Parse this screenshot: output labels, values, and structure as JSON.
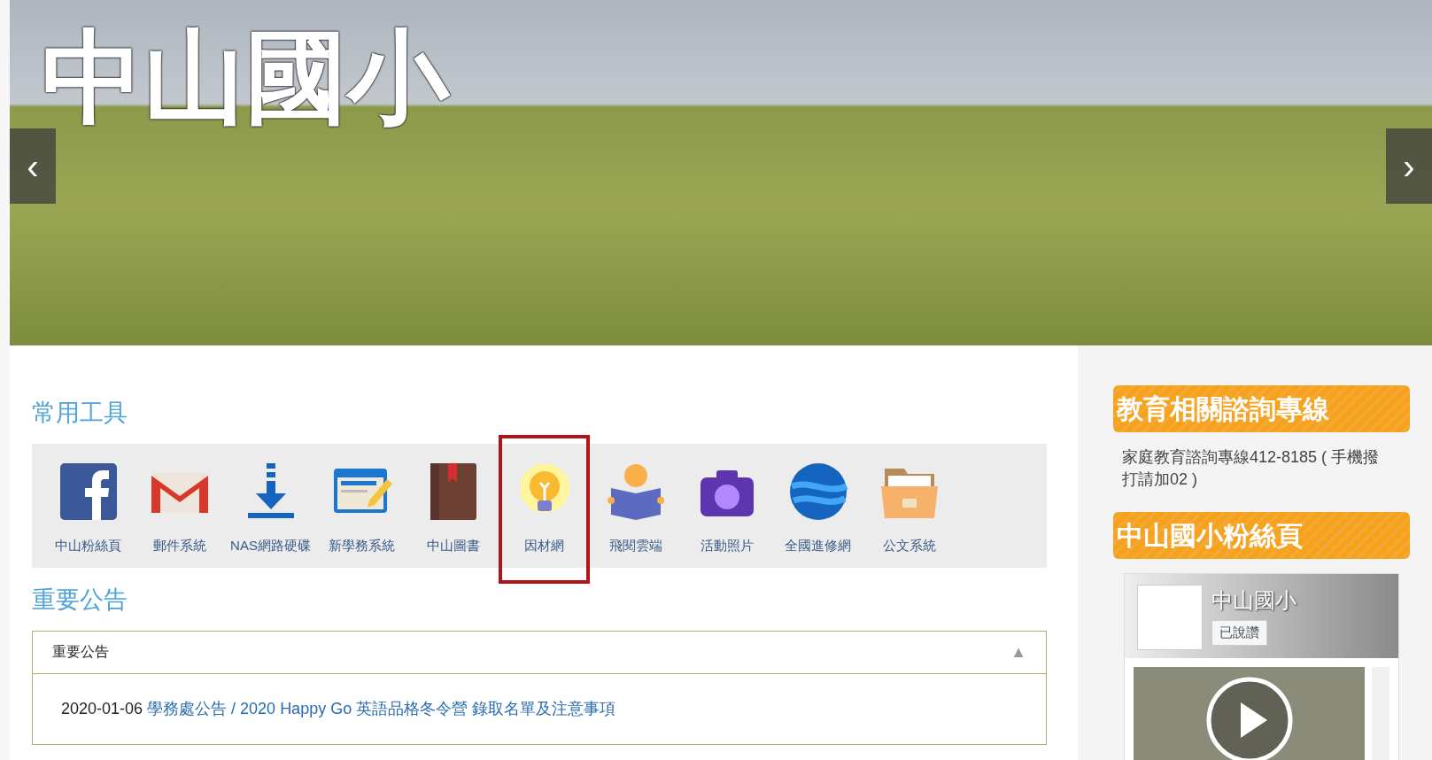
{
  "banner": {
    "logo": "中山國小",
    "prev": "‹",
    "next": "›"
  },
  "tools_heading": "常用工具",
  "tools": [
    {
      "kind": "facebook",
      "label": "中山粉絲頁",
      "highlighted": false
    },
    {
      "kind": "mail",
      "label": "郵件系統",
      "highlighted": false
    },
    {
      "kind": "download",
      "label": "NAS網路硬碟",
      "highlighted": false
    },
    {
      "kind": "form",
      "label": "新學務系統",
      "highlighted": false
    },
    {
      "kind": "book",
      "label": "中山圖書",
      "highlighted": false
    },
    {
      "kind": "bulb",
      "label": "因材網",
      "highlighted": true
    },
    {
      "kind": "reader",
      "label": "飛閱雲端",
      "highlighted": false
    },
    {
      "kind": "camera",
      "label": "活動照片",
      "highlighted": false
    },
    {
      "kind": "globe",
      "label": "全國進修網",
      "highlighted": false
    },
    {
      "kind": "folder",
      "label": "公文系統",
      "highlighted": false
    }
  ],
  "notice_heading": "重要公告",
  "notice_panel": {
    "title": "重要公告",
    "toggle": "▲",
    "expanded": true,
    "items": [
      {
        "date": "2020-01-06",
        "link": "學務處公告 / 2020 Happy Go 英語品格冬令營 錄取名單及注意事項"
      }
    ]
  },
  "sidebar": [
    {
      "kind": "text",
      "title": "教育相關諮詢專線",
      "body": "家庭教育諮詢專線412-8185 ( 手機撥打請加02 )"
    },
    {
      "kind": "facebook",
      "title": "中山國小粉絲頁",
      "page_name": "中山國小",
      "like": "已說讚"
    }
  ]
}
